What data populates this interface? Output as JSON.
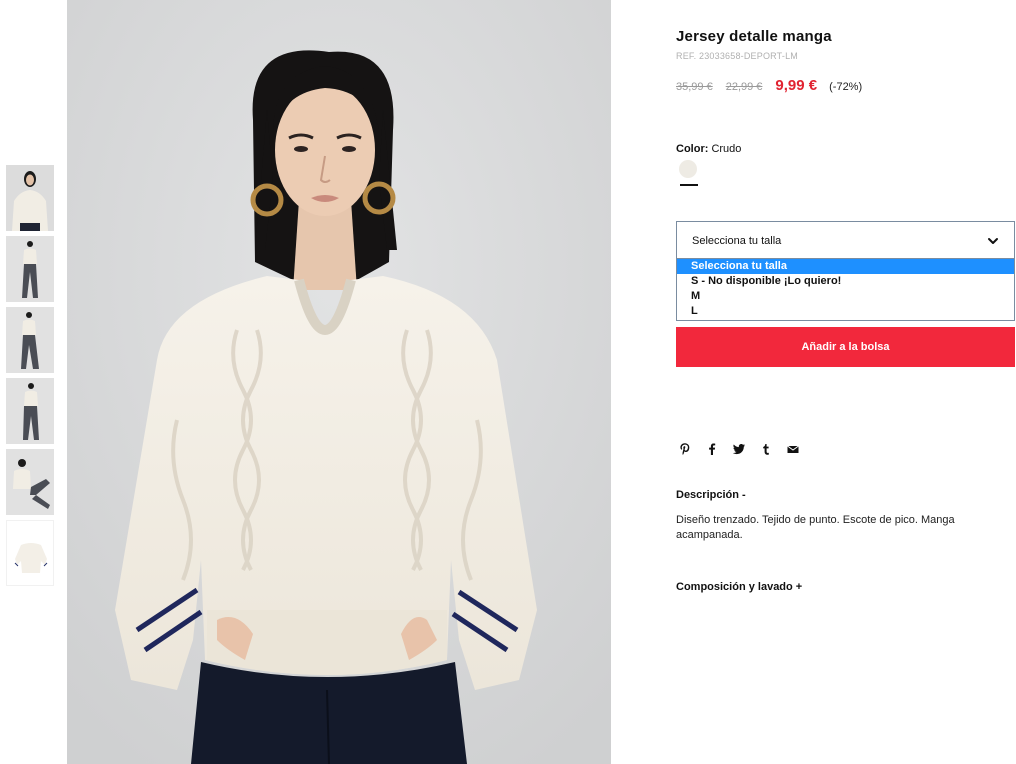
{
  "product": {
    "title": "Jersey detalle manga",
    "ref": "REF. 23033658-DEPORT-LM",
    "price_original": "35,99 €",
    "price_previous": "22,99 €",
    "price_current": "9,99 €",
    "discount": "(-72%)"
  },
  "color": {
    "label": "Color:",
    "value": "Crudo",
    "swatch_hex": "#eeebe4"
  },
  "size": {
    "select_label": "Selecciona tu talla",
    "options": [
      "Selecciona tu talla",
      "S - No disponible ¡Lo quiero!",
      "M",
      "L"
    ],
    "highlighted_index": 0
  },
  "actions": {
    "add_to_bag": "Añadir a la bolsa"
  },
  "share_icons": [
    "pinterest-icon",
    "facebook-icon",
    "twitter-icon",
    "tumblr-icon",
    "email-icon"
  ],
  "description": {
    "title": "Descripción -",
    "text": "Diseño trenzado. Tejido de punto. Escote de pico. Manga acampanada."
  },
  "composition": {
    "title": "Composición y lavado +"
  },
  "gallery": {
    "thumbnail_count": 6
  },
  "colors": {
    "accent_red": "#f2283c",
    "price_red": "#e12331",
    "select_highlight": "#1e90ff"
  }
}
